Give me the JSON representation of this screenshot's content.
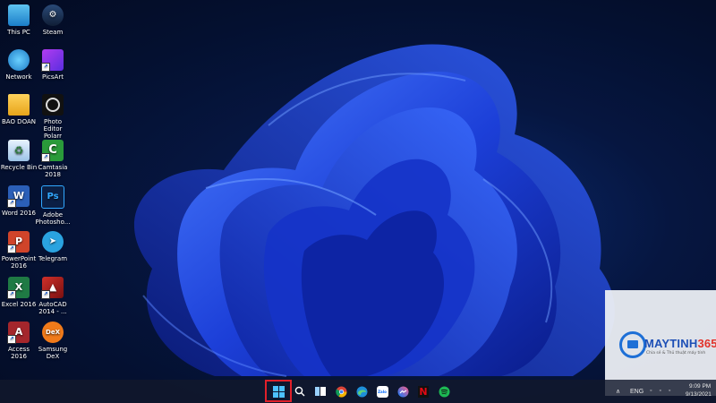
{
  "desktop": {
    "icons": [
      {
        "label": "This PC",
        "icon": "this-pc-icon"
      },
      {
        "label": "Steam",
        "icon": "steam-icon"
      },
      {
        "label": "Network",
        "icon": "network-icon"
      },
      {
        "label": "PicsArt",
        "icon": "picsart-icon"
      },
      {
        "label": "BAO DOAN",
        "icon": "folder-icon"
      },
      {
        "label": "Photo Editor Polarr",
        "icon": "polarr-icon"
      },
      {
        "label": "Recycle Bin",
        "icon": "recycle-bin-icon"
      },
      {
        "label": "Camtasia 2018",
        "icon": "camtasia-icon"
      },
      {
        "label": "Word 2016",
        "icon": "word-icon"
      },
      {
        "label": "Adobe Photosho...",
        "icon": "photoshop-icon"
      },
      {
        "label": "PowerPoint 2016",
        "icon": "powerpoint-icon"
      },
      {
        "label": "Telegram",
        "icon": "telegram-icon"
      },
      {
        "label": "Excel 2016",
        "icon": "excel-icon"
      },
      {
        "label": "AutoCAD 2014 - ...",
        "icon": "autocad-icon"
      },
      {
        "label": "Access 2016",
        "icon": "access-icon"
      },
      {
        "label": "Samsung DeX",
        "icon": "samsung-dex-icon"
      }
    ],
    "glyphs": {
      "word": "W",
      "photoshop": "Ps",
      "powerpoint": "P",
      "excel": "X",
      "access": "A",
      "dex": "DeX",
      "zalo": "Zalo",
      "netflix": "N"
    }
  },
  "watermark": {
    "title_main": "MAYTINH",
    "title_accent": "365",
    "subtitle": "Chia sẻ & Thủ thuật máy tính"
  },
  "taskbar": {
    "apps": [
      {
        "name": "start-button",
        "icon": "windows-logo-icon"
      },
      {
        "name": "search-button",
        "icon": "search-icon"
      },
      {
        "name": "task-view-button",
        "icon": "task-view-icon"
      },
      {
        "name": "chrome-button",
        "icon": "chrome-icon"
      },
      {
        "name": "edge-button",
        "icon": "edge-icon"
      },
      {
        "name": "zalo-button",
        "icon": "zalo-icon"
      },
      {
        "name": "messenger-button",
        "icon": "messenger-icon"
      },
      {
        "name": "netflix-button",
        "icon": "netflix-icon"
      },
      {
        "name": "spotify-button",
        "icon": "spotify-icon"
      }
    ],
    "tray": {
      "language": "ENG",
      "time": "9:09 PM",
      "date": "9/13/2021"
    }
  },
  "colors": {
    "highlight": "#e0202a",
    "brand_blue": "#1d4fb6",
    "brand_red": "#e2322a"
  }
}
